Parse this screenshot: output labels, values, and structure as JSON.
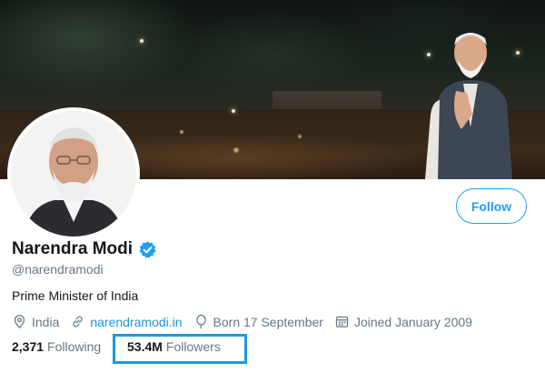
{
  "profile": {
    "display_name": "Narendra Modi",
    "handle": "@narendramodi",
    "bio": "Prime Minister of India",
    "verified": true,
    "follow_label": "Follow"
  },
  "meta": {
    "location": "India",
    "website": "narendramodi.in",
    "birthday": "Born 17 September",
    "joined": "Joined January 2009"
  },
  "stats": {
    "following_count": "2,371",
    "following_label": "Following",
    "followers_count": "53.4M",
    "followers_label": "Followers"
  },
  "icons": {
    "verified": "verified-badge-icon",
    "location": "location-pin-icon",
    "website": "link-icon",
    "birthday": "balloon-icon",
    "joined": "calendar-icon"
  },
  "colors": {
    "accent": "#1da1f2",
    "link": "#1b95e0",
    "muted": "#657786",
    "highlight_box": "#1a9be0"
  }
}
